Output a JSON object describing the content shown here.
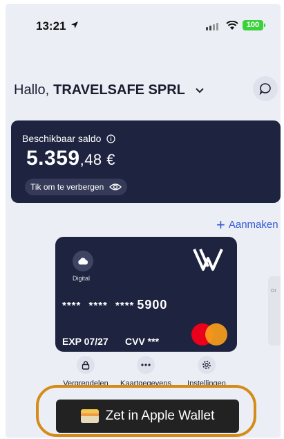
{
  "status_bar": {
    "time": "13:21",
    "battery": "100"
  },
  "header": {
    "greeting": "Hallo,",
    "account_name": "TRAVELSAFE SPRL"
  },
  "balance": {
    "label": "Beschikbaar saldo",
    "amount_main": "5.359",
    "amount_cents": ",48 €",
    "hide_label": "Tik om te verbergen"
  },
  "create_link": {
    "label": "Aanmaken"
  },
  "card": {
    "type_label": "Digital",
    "number_masked": "**** **** ****",
    "number_last": "5900",
    "expiry": "EXP 07/27",
    "cvv": "CVV ***",
    "next_card_peek": "Or"
  },
  "actions": [
    {
      "label": "Vergrendelen",
      "icon": "lock-icon"
    },
    {
      "label": "Kaartgegevens",
      "icon": "more-icon"
    },
    {
      "label": "Instellingen",
      "icon": "gear-icon"
    }
  ],
  "wallet_button": {
    "label": "Zet in Apple Wallet"
  },
  "colors": {
    "card_bg": "#1e2440",
    "accent": "#3256d6",
    "highlight": "#d58b19"
  }
}
